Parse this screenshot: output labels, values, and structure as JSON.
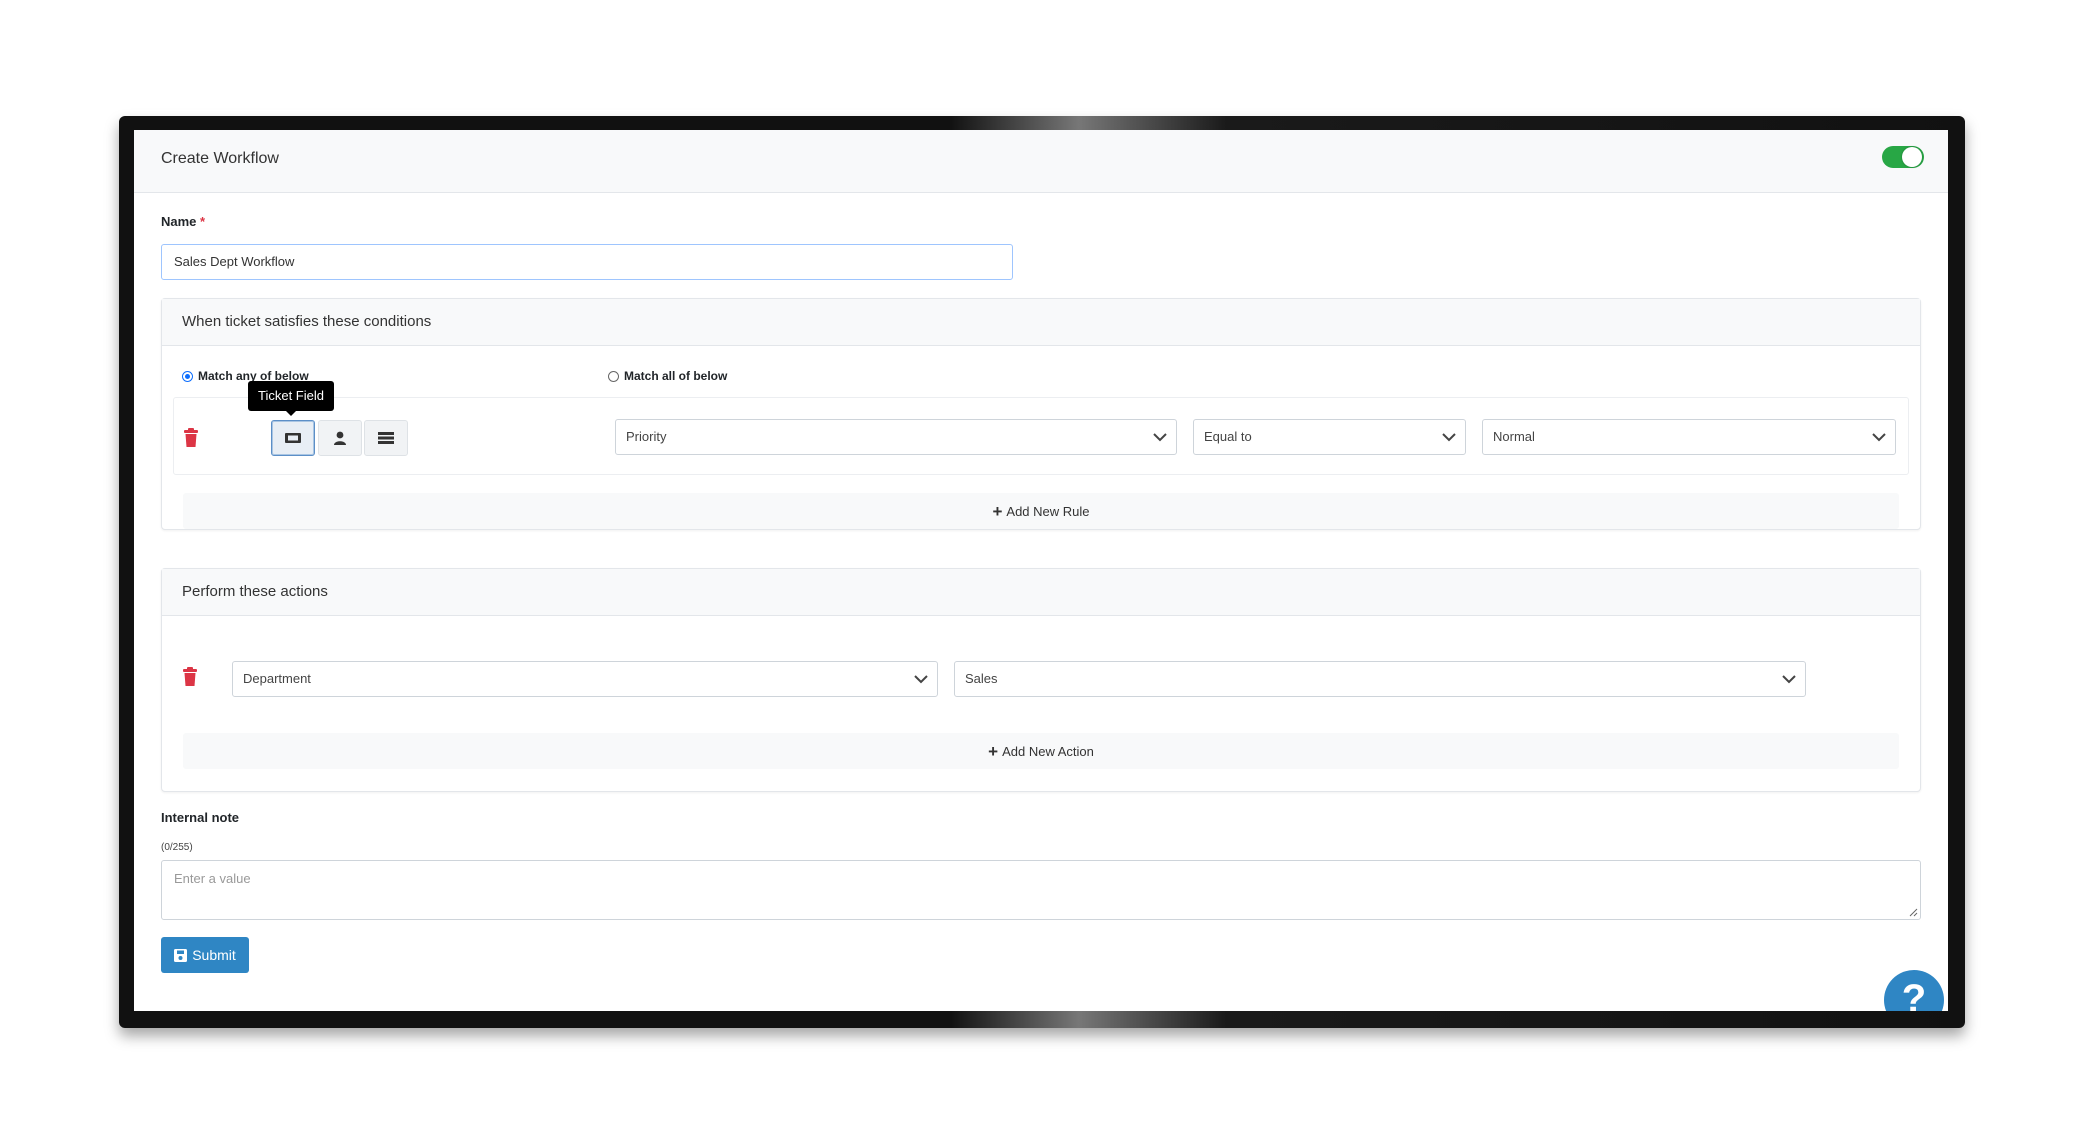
{
  "header": {
    "title": "Create Workflow",
    "active_toggle": true
  },
  "form": {
    "name_label": "Name",
    "required_marker": "*",
    "name_value": "Sales Dept Workflow"
  },
  "conditions": {
    "title": "When ticket satisfies these conditions",
    "match_any_label": "Match any of below",
    "match_all_label": "Match all of below",
    "selected_match": "any",
    "tooltip": "Ticket Field",
    "rule": {
      "field": "Priority",
      "operator": "Equal to",
      "value": "Normal"
    },
    "add_rule_label": "Add New Rule"
  },
  "actions": {
    "title": "Perform these actions",
    "action": {
      "field": "Department",
      "value": "Sales"
    },
    "add_action_label": "Add New Action"
  },
  "internal_note": {
    "label": "Internal note",
    "counter": "(0/255)",
    "placeholder": "Enter a value"
  },
  "submit_label": "Submit",
  "help_label": "?",
  "colors": {
    "primary": "#2f86c4",
    "danger": "#dc3545",
    "toggle_on": "#28a745"
  },
  "icons": [
    "ticket-icon",
    "user-icon",
    "list-icon",
    "trash-icon",
    "save-icon",
    "chevron-down-icon"
  ]
}
